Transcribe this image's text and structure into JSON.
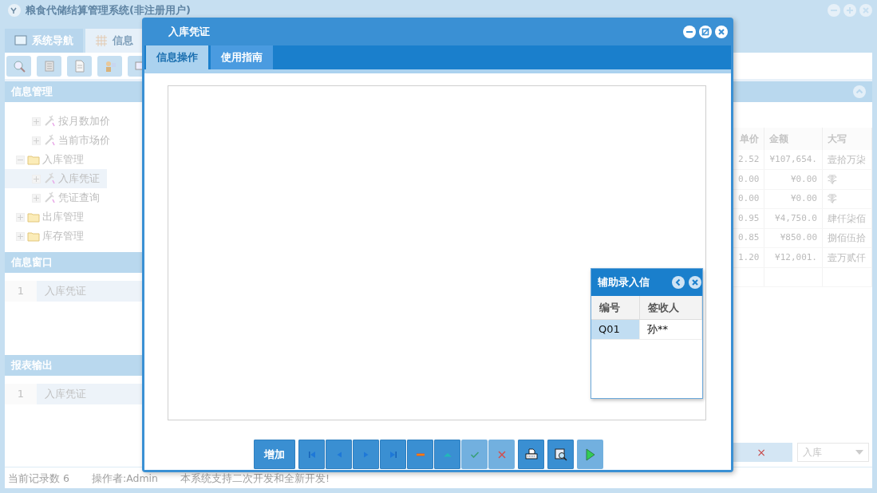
{
  "app": {
    "title": "粮食代储结算管理系统(非注册用户)",
    "tabs": [
      {
        "label": "系统导航",
        "selected": false
      },
      {
        "label": "信息",
        "selected": true
      }
    ],
    "sidebar": [
      {
        "title": "信息管理",
        "kind": "tree",
        "tree": [
          {
            "children": [
              {
                "label": "按月数加价",
                "kind": "leaf",
                "selected": false
              },
              {
                "label": "当前市场价",
                "kind": "leaf",
                "selected": false
              }
            ]
          },
          {
            "label": "入库管理",
            "kind": "folder",
            "expanded": true,
            "children": [
              {
                "label": "入库凭证",
                "kind": "leaf",
                "selected": true
              },
              {
                "label": "凭证查询",
                "kind": "leaf",
                "selected": false
              }
            ]
          },
          {
            "label": "出库管理",
            "kind": "folder",
            "expanded": false
          },
          {
            "label": "库存管理",
            "kind": "folder",
            "expanded": false
          }
        ]
      },
      {
        "title": "信息窗口",
        "kind": "list",
        "rows": [
          {
            "index": "1",
            "label": "入库凭证"
          }
        ]
      },
      {
        "title": "报表输出",
        "kind": "list",
        "rows": [
          {
            "index": "1",
            "label": "入库凭证"
          }
        ]
      }
    ],
    "grid": {
      "columns": [
        "单价",
        "金额",
        "大写"
      ],
      "rows": [
        [
          "2.52",
          "¥107,654.",
          "壹拾万柒"
        ],
        [
          "0.00",
          "¥0.00",
          "零"
        ],
        [
          "0.00",
          "¥0.00",
          "零"
        ],
        [
          "0.95",
          "¥4,750.0",
          "肆仟柒佰"
        ],
        [
          "0.85",
          "¥850.00",
          "捌佰伍拾"
        ],
        [
          "1.20",
          "¥12,001.",
          "壹万贰仟"
        ]
      ]
    },
    "filter": {
      "clear_label": "×",
      "value": "入库"
    },
    "status_bar": [
      "当前记录数 6",
      "操作者:Admin",
      "本系统支持二次开发和全新开发!"
    ]
  },
  "modal": {
    "title": "入库凭证",
    "tabs": [
      {
        "label": "信息操作",
        "selected": true
      },
      {
        "label": "使用指南",
        "selected": false
      }
    ],
    "popup": {
      "title": "辅助录入信",
      "columns": [
        "编号",
        "签收人"
      ],
      "rows": [
        {
          "cells": [
            "Q01",
            "孙**"
          ],
          "selected": true
        }
      ]
    },
    "button_groups": [
      [
        {
          "kind": "text",
          "label": "增加",
          "disabled": false
        }
      ],
      [
        {
          "kind": "first",
          "disabled": false
        },
        {
          "kind": "prev",
          "disabled": false
        },
        {
          "kind": "next",
          "disabled": false
        },
        {
          "kind": "last",
          "disabled": false
        },
        {
          "kind": "delete",
          "disabled": false
        },
        {
          "kind": "up",
          "disabled": false
        },
        {
          "kind": "save",
          "disabled": true
        },
        {
          "kind": "cancel",
          "disabled": true
        }
      ],
      [
        {
          "kind": "print",
          "disabled": false
        }
      ],
      [
        {
          "kind": "preview",
          "disabled": false
        }
      ],
      [
        {
          "kind": "run",
          "disabled": true
        }
      ]
    ]
  }
}
